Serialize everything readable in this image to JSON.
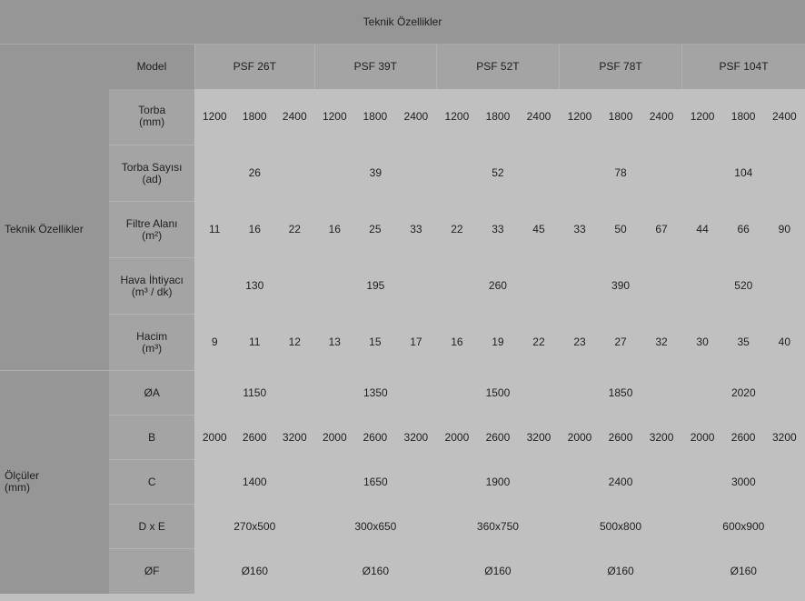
{
  "title": "Teknik Özellikler",
  "model_header": "Model",
  "models": [
    "PSF 26T",
    "PSF 39T",
    "PSF 52T",
    "PSF 78T",
    "PSF 104T"
  ],
  "groups": {
    "teknik": "Teknik Özellikler",
    "olculer_line1": "Ölçüler",
    "olculer_line2": "(mm)"
  },
  "rows": {
    "torba": {
      "label1": "Torba",
      "label2": "(mm)",
      "values": [
        "1200",
        "1800",
        "2400",
        "1200",
        "1800",
        "2400",
        "1200",
        "1800",
        "2400",
        "1200",
        "1800",
        "2400",
        "1200",
        "1800",
        "2400"
      ]
    },
    "torba_sayisi": {
      "label1": "Torba Sayısı",
      "label2": "(ad)",
      "values": [
        "26",
        "39",
        "52",
        "78",
        "104"
      ]
    },
    "filtre_alani": {
      "label1": "Filtre Alanı",
      "label2": "(m²)",
      "values": [
        "11",
        "16",
        "22",
        "16",
        "25",
        "33",
        "22",
        "33",
        "45",
        "33",
        "50",
        "67",
        "44",
        "66",
        "90"
      ]
    },
    "hava": {
      "label1": "Hava İhtiyacı",
      "label2": "(m³ / dk)",
      "values": [
        "130",
        "195",
        "260",
        "390",
        "520"
      ]
    },
    "hacim": {
      "label1": "Hacim",
      "label2": "(m³)",
      "values": [
        "9",
        "11",
        "12",
        "13",
        "15",
        "17",
        "16",
        "19",
        "22",
        "23",
        "27",
        "32",
        "30",
        "35",
        "40"
      ]
    },
    "a": {
      "label": "ØA",
      "values": [
        "1150",
        "1350",
        "1500",
        "1850",
        "2020"
      ]
    },
    "b": {
      "label": "B",
      "values": [
        "2000",
        "2600",
        "3200",
        "2000",
        "2600",
        "3200",
        "2000",
        "2600",
        "3200",
        "2000",
        "2600",
        "3200",
        "2000",
        "2600",
        "3200"
      ]
    },
    "c": {
      "label": "C",
      "values": [
        "1400",
        "1650",
        "1900",
        "2400",
        "3000"
      ]
    },
    "dxe": {
      "label": "D x E",
      "values": [
        "270x500",
        "300x650",
        "360x750",
        "500x800",
        "600x900"
      ]
    },
    "f": {
      "label": "ØF",
      "values": [
        "Ø160",
        "Ø160",
        "Ø160",
        "Ø160",
        "Ø160"
      ]
    }
  }
}
